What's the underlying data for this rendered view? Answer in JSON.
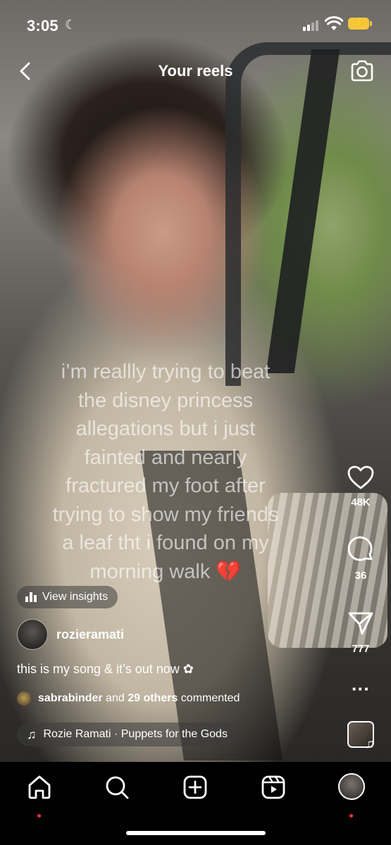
{
  "status_bar": {
    "time": "3:05",
    "battery_color": "#f4c73c"
  },
  "header": {
    "title": "Your reels"
  },
  "overlay_text": {
    "lines": [
      "i’m reallly trying to beat",
      "the disney princess",
      "allegations but i just",
      "fainted and nearly",
      "fractured my foot after",
      "trying to show my friends",
      "a leaf tht i found on my",
      "morning walk"
    ],
    "emoji": "💔"
  },
  "actions": {
    "likes": "48K",
    "comments": "36",
    "shares": "777"
  },
  "insights": {
    "label": "View insights"
  },
  "author": {
    "username": "rozieramati"
  },
  "caption": "this is my song & it’s out now ✿",
  "comments_summary": {
    "user": "sabrabinder",
    "middle": "and",
    "others": "29 others",
    "suffix": "commented"
  },
  "music": {
    "label": "Rozie Ramati · Puppets for the Gods"
  },
  "nav": {
    "items": [
      "home",
      "search",
      "create",
      "reels",
      "profile"
    ],
    "notification_color": "#ff3040"
  }
}
